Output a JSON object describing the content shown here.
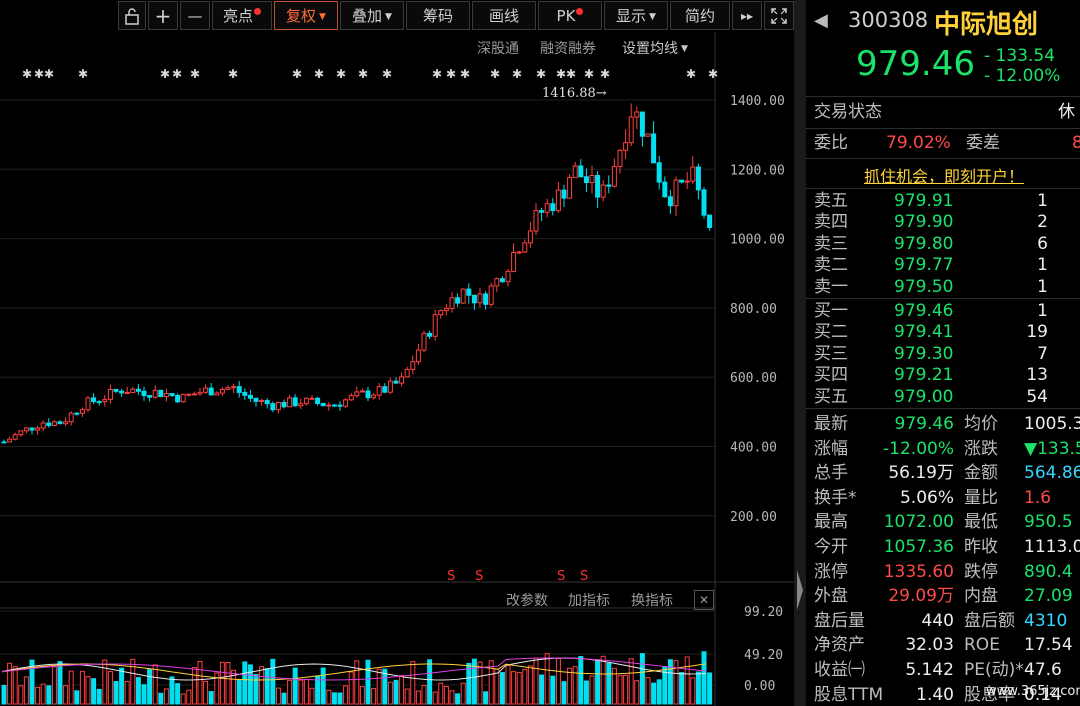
{
  "toolbar": {
    "buttons": [
      {
        "label": "亮点",
        "dot": true
      },
      {
        "label": "复权",
        "caret": true,
        "active": true
      },
      {
        "label": "叠加",
        "caret": true
      },
      {
        "label": "筹码"
      },
      {
        "label": "画线"
      },
      {
        "label": "PK",
        "dot": true
      },
      {
        "label": "显示",
        "caret": true
      },
      {
        "label": "简约"
      }
    ],
    "plus": "+",
    "minus": "—",
    "next": "▸▸"
  },
  "chart_links": {
    "a": "深股通",
    "b": "融资融券",
    "c": "设置均线"
  },
  "max_price_label": "1416.88→",
  "y_axis_labels": [
    "1400.00",
    "1200.00",
    "1000.00",
    "800.00",
    "600.00",
    "400.00",
    "200.00"
  ],
  "indicator_links": {
    "a": "改参数",
    "b": "加指标",
    "c": "换指标",
    "close": "✕"
  },
  "volume_axis_labels": [
    "99.20",
    "49.20",
    "0.00"
  ],
  "chart_data": {
    "type": "candlestick",
    "ylim": [
      0,
      1500
    ],
    "yticks": [
      200,
      400,
      600,
      800,
      1000,
      1200,
      1400
    ],
    "max_marker": 1416.88,
    "colors": {
      "up": "#ff4040",
      "down": "#00e0f0"
    }
  },
  "stock": {
    "code": "300308",
    "name": "中际旭创",
    "price": "979.46",
    "change": "- 133.54",
    "change_pct": "- 12.00%",
    "back": "◀"
  },
  "status": {
    "label": "交易状态",
    "value": "休"
  },
  "weibi": {
    "label1": "委比",
    "value1": "79.02%",
    "label2": "委差",
    "value2": "8"
  },
  "banner": "抓住机会，即刻开户！",
  "sell": [
    {
      "label": "卖五",
      "price": "979.91",
      "vol": "1"
    },
    {
      "label": "卖四",
      "price": "979.90",
      "vol": "2"
    },
    {
      "label": "卖三",
      "price": "979.80",
      "vol": "6"
    },
    {
      "label": "卖二",
      "price": "979.77",
      "vol": "1"
    },
    {
      "label": "卖一",
      "price": "979.50",
      "vol": "1"
    }
  ],
  "buy": [
    {
      "label": "买一",
      "price": "979.46",
      "vol": "1"
    },
    {
      "label": "买二",
      "price": "979.41",
      "vol": "19"
    },
    {
      "label": "买三",
      "price": "979.30",
      "vol": "7"
    },
    {
      "label": "买四",
      "price": "979.21",
      "vol": "13"
    },
    {
      "label": "买五",
      "price": "979.00",
      "vol": "54"
    }
  ],
  "stats": [
    {
      "l1": "最新",
      "v1": "979.46",
      "c1": "green",
      "l2": "均价",
      "v2": "1005.3",
      "c2": "white"
    },
    {
      "l1": "涨幅",
      "v1": "-12.00%",
      "c1": "green",
      "l2": "涨跌",
      "v2": "▼133.5",
      "c2": "green"
    },
    {
      "l1": "总手",
      "v1": "56.19万",
      "c1": "white",
      "l2": "金额",
      "v2": "564.86",
      "c2": "cyan"
    },
    {
      "l1": "换手*",
      "v1": "5.06%",
      "c1": "white",
      "l2": "量比",
      "v2": "1.6",
      "c2": "red"
    },
    {
      "l1": "最高",
      "v1": "1072.00",
      "c1": "green",
      "l2": "最低",
      "v2": "950.5",
      "c2": "green"
    },
    {
      "l1": "今开",
      "v1": "1057.36",
      "c1": "green",
      "l2": "昨收",
      "v2": "1113.0",
      "c2": "white"
    },
    {
      "l1": "涨停",
      "v1": "1335.60",
      "c1": "red",
      "l2": "跌停",
      "v2": "890.4",
      "c2": "green"
    },
    {
      "l1": "外盘",
      "v1": "29.09万",
      "c1": "red",
      "l2": "内盘",
      "v2": "27.09",
      "c2": "green"
    },
    {
      "l1": "盘后量",
      "v1": "440",
      "c1": "white",
      "l2": "盘后额",
      "v2": "4310",
      "c2": "cyan"
    },
    {
      "l1": "净资产",
      "v1": "32.03",
      "c1": "white",
      "l2": "ROE",
      "v2": "17.54",
      "c2": "white"
    },
    {
      "l1": "收益㈠",
      "v1": "5.142",
      "c1": "white",
      "l2": "PE(动)*",
      "v2": "47.6",
      "c2": "white"
    },
    {
      "l1": "股息TTM",
      "v1": "1.40",
      "c1": "white",
      "l2": "股息率",
      "v2": "0.14",
      "c2": "white"
    }
  ],
  "watermark": "www.365jz.com"
}
